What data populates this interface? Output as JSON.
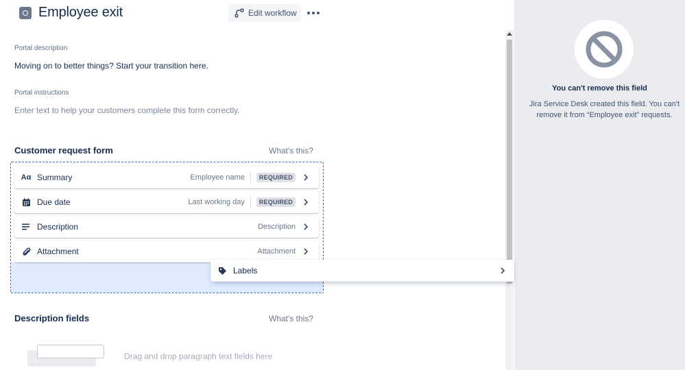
{
  "header": {
    "title": "Employee exit",
    "edit_workflow_label": "Edit workflow",
    "page_icon": "portal-icon",
    "more_icon": "more-icon"
  },
  "portal": {
    "description_label": "Portal description",
    "description_text": "Moving on to better things? Start your transition here.",
    "instructions_label": "Portal instructions",
    "instructions_placeholder": "Enter text to help your customers complete this form correctly."
  },
  "request_form": {
    "title": "Customer request form",
    "help_link": "What's this?",
    "fields": [
      {
        "label": "Summary",
        "value": "Employee name",
        "required": "REQUIRED",
        "icon": "text-format-icon",
        "icon_glyph": "Aα"
      },
      {
        "label": "Due date",
        "value": "Last working day",
        "required": "REQUIRED",
        "icon": "calendar-icon"
      },
      {
        "label": "Description",
        "value": "Description",
        "icon": "align-left-icon"
      },
      {
        "label": "Attachment",
        "value": "Attachment",
        "icon": "paperclip-icon"
      }
    ],
    "dragging_field": {
      "label": "Labels",
      "icon": "tag-icon"
    }
  },
  "description_fields": {
    "title": "Description fields",
    "help_link": "What's this?",
    "drop_hint": "Drag and drop paragraph text fields here"
  },
  "side_panel": {
    "icon": "no-entry-icon",
    "title": "You can't remove this field",
    "description": "Jira Service Desk created this field. You can't remove it from “Employee exit” requests."
  },
  "colors": {
    "drop_zone_border": "#2a6ed6",
    "drop_zone_fill": "#deebff",
    "panel_bg": "#ebecf0",
    "text_primary": "#172b4d"
  }
}
